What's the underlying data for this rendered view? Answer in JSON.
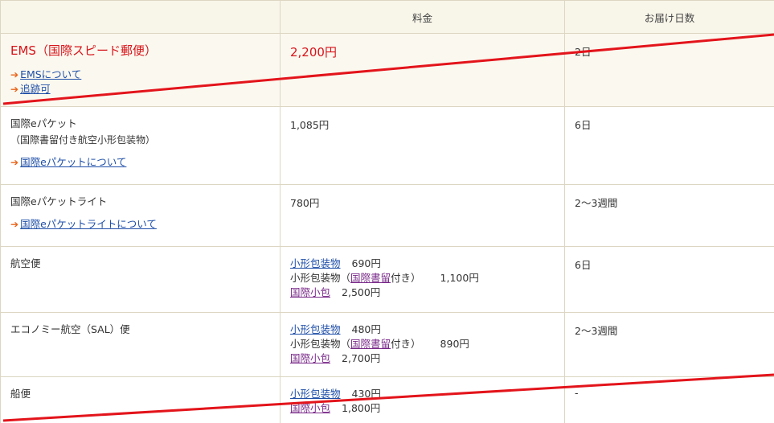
{
  "header": {
    "col1": "",
    "col2": "料金",
    "col3": "お届け日数"
  },
  "rows": {
    "ems": {
      "name": "EMS（国際スピード郵便）",
      "price": "2,200円",
      "days": "2日",
      "links": [
        "EMSについて",
        "追跡可"
      ]
    },
    "epacket": {
      "name": "国際eパケット",
      "sub": "（国際書留付き航空小形包装物）",
      "price": "1,085円",
      "days": "6日",
      "links": [
        "国際eパケットについて"
      ]
    },
    "epacket_lite": {
      "name": "国際eパケットライト",
      "price": "780円",
      "days": "2〜3週間",
      "links": [
        "国際eパケットライトについて"
      ]
    },
    "air": {
      "name": "航空便",
      "days": "6日",
      "prices": {
        "small_link": "小形包装物",
        "small_amt": "690円",
        "reg_prefix": "小形包装物（",
        "reg_link": "国際書留",
        "reg_suffix": "付き）",
        "reg_amt": "1,100円",
        "parcel_link": "国際小包",
        "parcel_amt": "2,500円"
      }
    },
    "sal": {
      "name": "エコノミー航空（SAL）便",
      "days": "2〜3週間",
      "prices": {
        "small_link": "小形包装物",
        "small_amt": "480円",
        "reg_prefix": "小形包装物（",
        "reg_link": "国際書留",
        "reg_suffix": "付き）",
        "reg_amt": "890円",
        "parcel_link": "国際小包",
        "parcel_amt": "2,700円"
      }
    },
    "ship": {
      "name": "船便",
      "days": "-",
      "prices": {
        "small_link": "小形包装物",
        "small_amt": "430円",
        "parcel_link": "国際小包",
        "parcel_amt": "1,800円"
      }
    }
  },
  "colors": {
    "strike": "#e3141b",
    "ems_text": "#d7141a",
    "link": "#1f4fa8",
    "visited_link": "#7a2a8a",
    "arrow": "#e8641b",
    "header_bg": "#f8f5e9",
    "border": "#dcd6c2"
  }
}
